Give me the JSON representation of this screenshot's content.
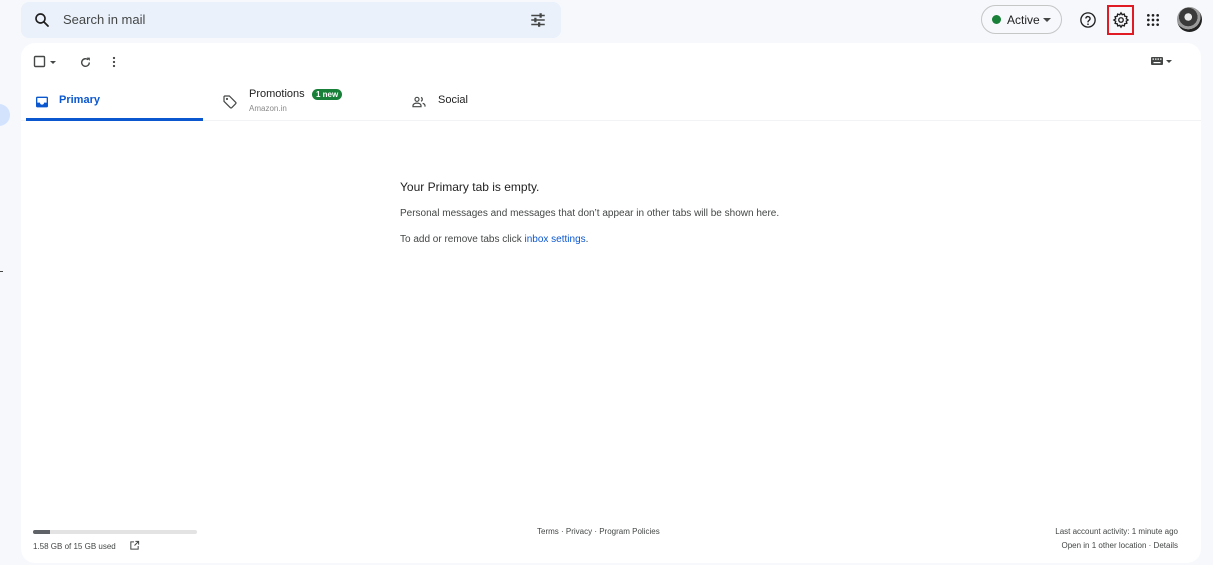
{
  "search": {
    "placeholder": "Search in mail",
    "icon": "search-icon",
    "options_icon": "tune-icon"
  },
  "status": {
    "label": "Active",
    "color": "#188038"
  },
  "header_icons": [
    "help-icon",
    "gear-icon",
    "apps-icon",
    "avatar"
  ],
  "tabs": [
    {
      "label": "Primary",
      "icon": "inbox-icon",
      "selected": true
    },
    {
      "label": "Promotions",
      "icon": "tag-icon",
      "badge": "1 new",
      "subtitle": "Amazon.in"
    },
    {
      "label": "Social",
      "icon": "people-icon"
    }
  ],
  "empty_state": {
    "title": "Your Primary tab is empty.",
    "line1": "Personal messages and messages that don’t appear in other tabs will be shown here.",
    "line2_prefix": "To add or remove tabs click ",
    "line2_link": "inbox settings",
    "line2_suffix": "."
  },
  "storage": {
    "label": "1.58 GB of 15 GB used",
    "used_fraction": 0.105
  },
  "footer": {
    "links": "Terms · Privacy · Program Policies",
    "activity": "Last account activity: 1 minute ago",
    "details": "Open in 1 other location · Details"
  },
  "colors": {
    "accent": "#0b57d0",
    "badge": "#188038",
    "highlight": "#e01b24"
  }
}
